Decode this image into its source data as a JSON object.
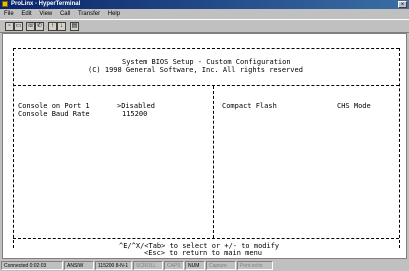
{
  "window": {
    "title": "ProLinx - HyperTerminal",
    "close_label": "×"
  },
  "menu": [
    "File",
    "Edit",
    "View",
    "Call",
    "Transfer",
    "Help"
  ],
  "toolbar_icons": [
    "new-icon",
    "open-icon",
    "connect-icon",
    "disconnect-icon",
    "send-icon",
    "receive-icon",
    "properties-icon"
  ],
  "bios": {
    "title": "System BIOS Setup - Custom Configuration",
    "copyright": "(C) 1998 General Software, Inc. All rights reserved",
    "rows": [
      {
        "label": "Console on Port 1",
        "value": ">Disabled"
      },
      {
        "label": "Console Baud Rate",
        "value": "115200"
      }
    ],
    "right_labels": {
      "compact_flash": "Compact Flash",
      "chs_mode": "CHS Mode"
    },
    "footer_line1": "^E/^X/<Tab> to select or +/- to modify",
    "footer_line2": "<Esc> to return to main menu"
  },
  "status": {
    "connected": "Connected 0:02:03",
    "emulation": "ANSIW",
    "settings": "115200 8-N-1",
    "scroll": "SCROLL",
    "caps": "CAPS",
    "num": "NUM",
    "capture": "Capture",
    "print_echo": "Print echo"
  }
}
